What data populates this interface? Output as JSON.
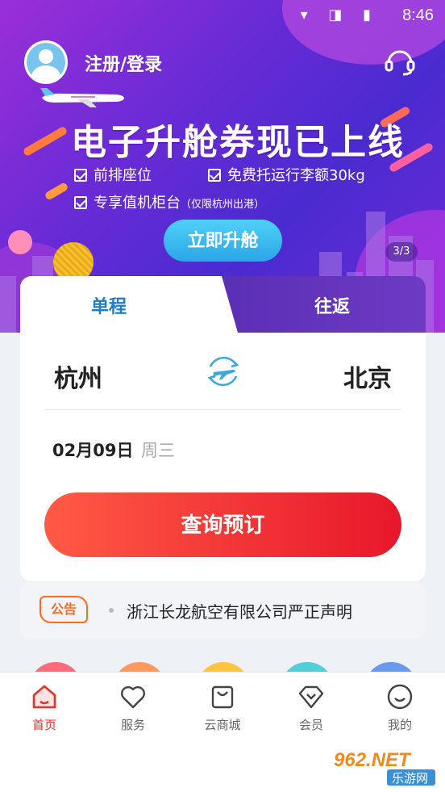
{
  "status_bar": {
    "time": "8:46",
    "icons": "▾ ◨ ▮"
  },
  "header": {
    "login_label": "注册/登录"
  },
  "banner": {
    "title": "电子升舱券现已上线",
    "features": [
      "前排座位",
      "免费托运行李额30kg",
      "专享值机柜台"
    ],
    "feature_note": "（仅限杭州出港）",
    "button_label": "立即升舱",
    "pager": "3/3"
  },
  "booking": {
    "tabs": {
      "one_way": "单程",
      "round_trip": "往返"
    },
    "from_city": "杭州",
    "to_city": "北京",
    "date": "02月09日",
    "weekday": "周三",
    "search_label": "查询预订"
  },
  "notice": {
    "tag": "公告",
    "text": "浙江长龙航空有限公司严正声明"
  },
  "nav": [
    {
      "label": "首页",
      "icon": "home-icon",
      "active": true
    },
    {
      "label": "服务",
      "icon": "heart-icon",
      "active": false
    },
    {
      "label": "云商城",
      "icon": "bag-icon",
      "active": false
    },
    {
      "label": "会员",
      "icon": "diamond-icon",
      "active": false
    },
    {
      "label": "我的",
      "icon": "smile-icon",
      "active": false
    }
  ],
  "watermark": {
    "brand": "962.NET",
    "sub": "乐游网"
  },
  "colors": {
    "accent": "#e8322b",
    "tab_active": "#1f7dc7",
    "notice": "#ff6a1f",
    "upgrade": "#2aa6e8"
  }
}
